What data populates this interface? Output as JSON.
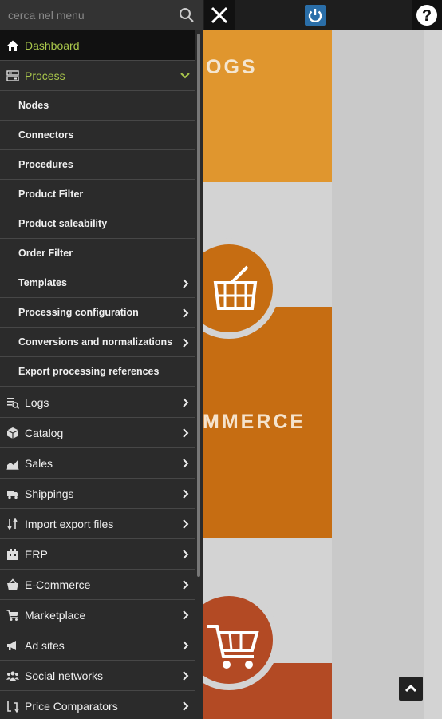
{
  "search": {
    "placeholder": "cerca nel menu"
  },
  "content": {
    "card_logs_text": "OGS",
    "card_ecommerce_text": "MMERCE"
  },
  "menu": {
    "dashboard": "Dashboard",
    "process": "Process",
    "subitems": [
      {
        "label": "Nodes",
        "has_children": false
      },
      {
        "label": "Connectors",
        "has_children": false
      },
      {
        "label": "Procedures",
        "has_children": false
      },
      {
        "label": "Product Filter",
        "has_children": false
      },
      {
        "label": "Product saleability",
        "has_children": false
      },
      {
        "label": "Order Filter",
        "has_children": false
      },
      {
        "label": "Templates",
        "has_children": true
      },
      {
        "label": "Processing configuration",
        "has_children": true
      },
      {
        "label": "Conversions and normalizations",
        "has_children": true
      },
      {
        "label": "Export processing references",
        "has_children": false
      }
    ],
    "items": [
      {
        "label": "Logs",
        "icon": "logs-icon"
      },
      {
        "label": "Catalog",
        "icon": "box-icon"
      },
      {
        "label": "Sales",
        "icon": "chart-icon"
      },
      {
        "label": "Shippings",
        "icon": "truck-icon"
      },
      {
        "label": "Import export files",
        "icon": "transfer-icon"
      },
      {
        "label": "ERP",
        "icon": "building-icon"
      },
      {
        "label": "E-Commerce",
        "icon": "basket-icon"
      },
      {
        "label": "Marketplace",
        "icon": "cart-icon"
      },
      {
        "label": "Ad sites",
        "icon": "megaphone-icon"
      },
      {
        "label": "Social networks",
        "icon": "users-icon"
      },
      {
        "label": "Price Comparators",
        "icon": "compare-icon"
      }
    ]
  },
  "colors": {
    "accent": "#a9c64b",
    "menu_bg": "#2b2b2b",
    "logs_card": "#e0962e",
    "ecommerce_card": "#c66d12",
    "marketplace_card": "#b34a24"
  }
}
